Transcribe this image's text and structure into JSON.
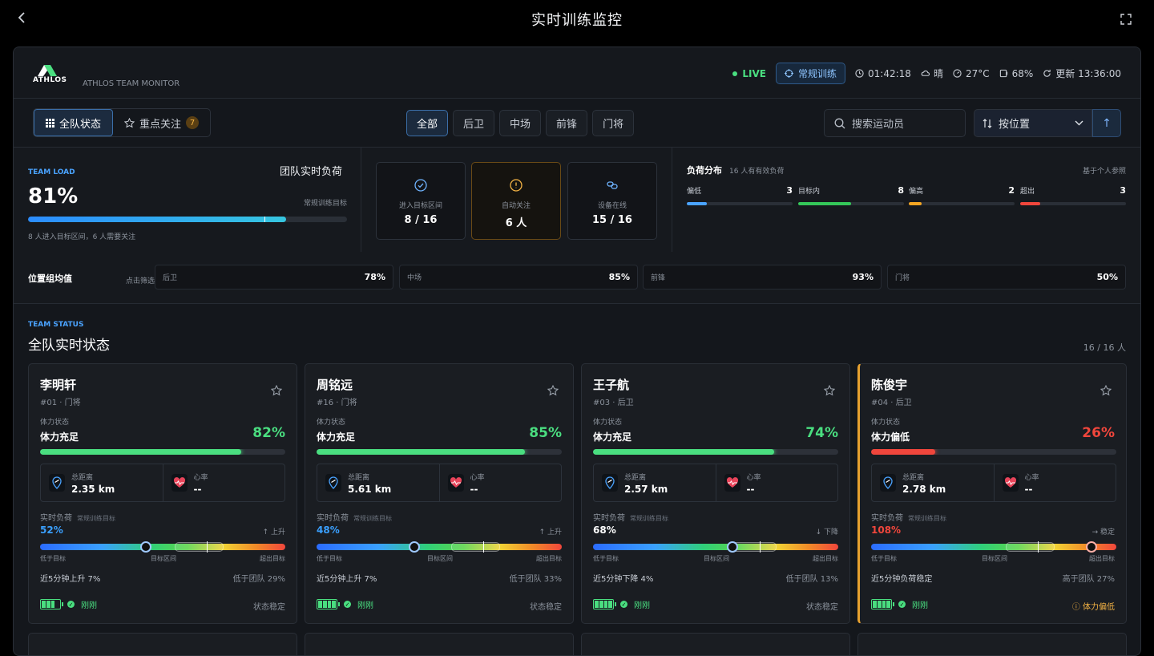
{
  "topbar": {
    "title": "实时训练监控"
  },
  "header": {
    "logo_text": "ATHLOS",
    "logo_sub": "ATHLOS TEAM MONITOR",
    "live": "LIVE",
    "mode": "常规训练",
    "timer": "01:42:18",
    "weather": "晴",
    "temp": "27°C",
    "humidity": "68%",
    "updated": "更新 13:36:00"
  },
  "toolbar": {
    "view_all": "全队状态",
    "view_focus": "重点关注",
    "focus_count": "7",
    "positions": [
      "全部",
      "后卫",
      "中场",
      "前锋",
      "门将"
    ],
    "search_placeholder": "搜索运动员",
    "sort_label": "按位置",
    "sort_dir": "↑"
  },
  "team_load": {
    "label": "TEAM LOAD",
    "title": "团队实时负荷",
    "value": "81%",
    "value_pct": 81,
    "target": "常规训练目标",
    "note": "8 人进入目标区间，6 人需要关注"
  },
  "stats": [
    {
      "label": "进入目标区间",
      "value": "8 / 16",
      "icon": "check-circle-icon"
    },
    {
      "label": "自动关注",
      "value": "6 人",
      "icon": "alert-circle-icon"
    },
    {
      "label": "设备在线",
      "value": "15 / 16",
      "icon": "link-icon"
    }
  ],
  "distribution": {
    "title": "负荷分布",
    "sub": "16 人有有效负荷",
    "right": "基于个人参照",
    "items": [
      {
        "label": "偏低",
        "count": "3",
        "color": "#4aa3ff",
        "frac": 0.19
      },
      {
        "label": "目标内",
        "count": "8",
        "color": "#34c759",
        "frac": 0.5
      },
      {
        "label": "偏高",
        "count": "2",
        "color": "#f5a623",
        "frac": 0.12
      },
      {
        "label": "超出",
        "count": "3",
        "color": "#f0463c",
        "frac": 0.19
      }
    ]
  },
  "position_avg": {
    "title": "位置组均值",
    "hint": "点击筛选",
    "items": [
      {
        "name": "后卫",
        "value": "78%"
      },
      {
        "name": "中场",
        "value": "85%"
      },
      {
        "name": "前锋",
        "value": "93%"
      },
      {
        "name": "门将",
        "value": "50%"
      }
    ]
  },
  "team_status": {
    "label": "TEAM STATUS",
    "title": "全队实时状态",
    "count": "16 / 16 人"
  },
  "players": [
    {
      "name": "李明轩",
      "sub": "#01 · 门将",
      "state_label": "体力状态",
      "state": "体力充足",
      "stamina": "82%",
      "stamina_pct": 82,
      "stamina_color": "#4ade80",
      "distance_label": "总距离",
      "distance": "2.35 km",
      "hr_label": "心率",
      "hr": "--",
      "load_label": "实时负荷",
      "load_target": "常规训练目标",
      "load": "52%",
      "load_pos": 0.43,
      "load_color": "#3aa0ff",
      "trend": "↑ 上升",
      "g_low": "低于目标",
      "g_mid": "目标区间",
      "g_high": "超出目标",
      "cmp_left": "近5分钟上升 7%",
      "cmp_right": "低于团队 29%",
      "battery": 3,
      "sync": "刚刚",
      "status": "状态稳定",
      "alert": false
    },
    {
      "name": "周铭远",
      "sub": "#16 · 门将",
      "state_label": "体力状态",
      "state": "体力充足",
      "stamina": "85%",
      "stamina_pct": 85,
      "stamina_color": "#4ade80",
      "distance_label": "总距离",
      "distance": "5.61 km",
      "hr_label": "心率",
      "hr": "--",
      "load_label": "实时负荷",
      "load_target": "常规训练目标",
      "load": "48%",
      "load_pos": 0.4,
      "load_color": "#3aa0ff",
      "trend": "↑ 上升",
      "g_low": "低于目标",
      "g_mid": "目标区间",
      "g_high": "超出目标",
      "cmp_left": "近5分钟上升 7%",
      "cmp_right": "低于团队 33%",
      "battery": 4,
      "sync": "刚刚",
      "status": "状态稳定",
      "alert": false
    },
    {
      "name": "王子航",
      "sub": "#03 · 后卫",
      "state_label": "体力状态",
      "state": "体力充足",
      "stamina": "74%",
      "stamina_pct": 74,
      "stamina_color": "#4ade80",
      "distance_label": "总距离",
      "distance": "2.57 km",
      "hr_label": "心率",
      "hr": "--",
      "load_label": "实时负荷",
      "load_target": "常规训练目标",
      "load": "68%",
      "load_pos": 0.57,
      "load_color": "#ffffff",
      "trend": "↓ 下降",
      "g_low": "低于目标",
      "g_mid": "目标区间",
      "g_high": "超出目标",
      "cmp_left": "近5分钟下降 4%",
      "cmp_right": "低于团队 13%",
      "battery": 4,
      "sync": "刚刚",
      "status": "状态稳定",
      "alert": false
    },
    {
      "name": "陈俊宇",
      "sub": "#04 · 后卫",
      "state_label": "体力状态",
      "state": "体力偏低",
      "stamina": "26%",
      "stamina_pct": 26,
      "stamina_color": "#f0463c",
      "distance_label": "总距离",
      "distance": "2.78 km",
      "hr_label": "心率",
      "hr": "--",
      "load_label": "实时负荷",
      "load_target": "常规训练目标",
      "load": "108%",
      "load_pos": 0.9,
      "load_color": "#f0463c",
      "trend": "→ 稳定",
      "g_low": "低于目标",
      "g_mid": "目标区间",
      "g_high": "超出目标",
      "cmp_left": "近5分钟负荷稳定",
      "cmp_right": "高于团队 27%",
      "battery": 4,
      "sync": "刚刚",
      "status": "ⓘ 体力偏低",
      "alert": true
    }
  ],
  "colors": {
    "accent": "#4aa3ff",
    "good": "#4ade80",
    "warn": "#f5b445",
    "bad": "#f0463c"
  }
}
